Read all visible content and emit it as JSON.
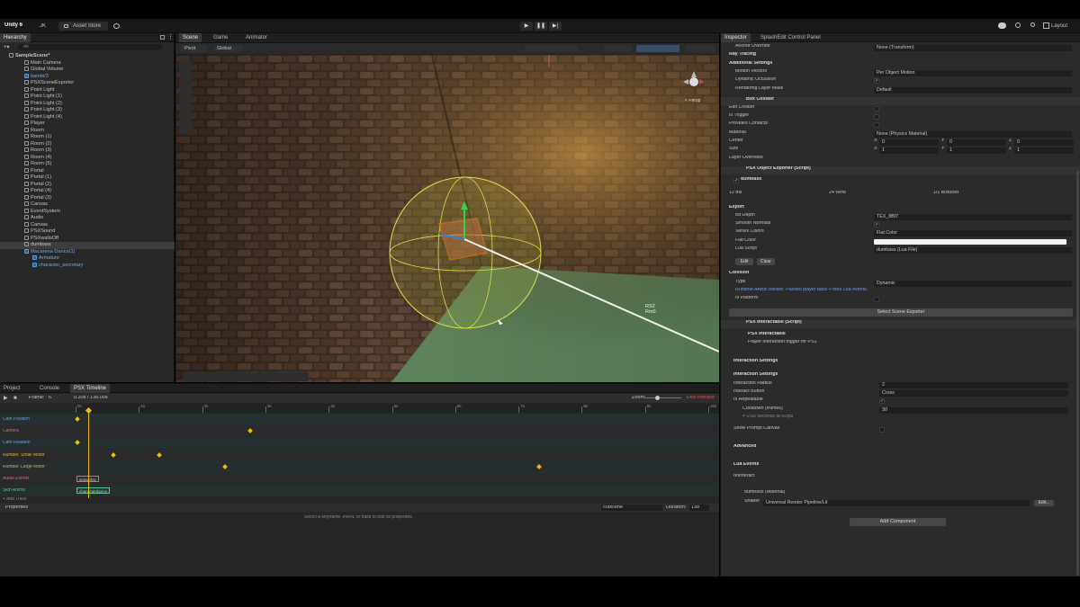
{
  "topbar": {
    "app": "Unity 6",
    "account": "JK",
    "store": "Asset Store",
    "layout": "Layout"
  },
  "hierarchy": {
    "tab": "Hierarchy",
    "search": "All",
    "items": [
      {
        "label": "SampleScene*",
        "indent": 0,
        "bold": true
      },
      {
        "label": "Main Camera",
        "indent": 1
      },
      {
        "label": "Global Volume",
        "indent": 1
      },
      {
        "label": "bambi/3",
        "indent": 1,
        "blue": true
      },
      {
        "label": "PSXSceneExporter",
        "indent": 1
      },
      {
        "label": "Point Light",
        "indent": 1
      },
      {
        "label": "Point Light (1)",
        "indent": 1
      },
      {
        "label": "Point Light (2)",
        "indent": 1
      },
      {
        "label": "Point Light (3)",
        "indent": 1
      },
      {
        "label": "Point Light (4)",
        "indent": 1
      },
      {
        "label": "Player",
        "indent": 1
      },
      {
        "label": "Room",
        "indent": 1
      },
      {
        "label": "Room (1)",
        "indent": 1
      },
      {
        "label": "Room (2)",
        "indent": 1
      },
      {
        "label": "Room (3)",
        "indent": 1
      },
      {
        "label": "Room (4)",
        "indent": 1
      },
      {
        "label": "Room (5)",
        "indent": 1
      },
      {
        "label": "Portal",
        "indent": 1
      },
      {
        "label": "Portal (1)",
        "indent": 1
      },
      {
        "label": "Portal (2)",
        "indent": 1
      },
      {
        "label": "Portal (4)",
        "indent": 1
      },
      {
        "label": "Portal (3)",
        "indent": 1
      },
      {
        "label": "Canvas",
        "indent": 1
      },
      {
        "label": "EventSystem",
        "indent": 1
      },
      {
        "label": "Audio",
        "indent": 1
      },
      {
        "label": "Canvas",
        "indent": 1
      },
      {
        "label": "PSXSound",
        "indent": 1
      },
      {
        "label": "PSXwallsOff",
        "indent": 1
      },
      {
        "label": "dumbass",
        "indent": 1,
        "selected": true
      },
      {
        "label": "Macarena Dance(1)",
        "indent": 1,
        "blue": true
      },
      {
        "label": "Armature",
        "indent": 2,
        "blue": true
      },
      {
        "label": "character_secretary",
        "indent": 2,
        "blue": true
      }
    ]
  },
  "scene": {
    "tabs": [
      "Scene",
      "Game",
      "Animator"
    ],
    "pivot": "Pivot",
    "global": "Global",
    "persp": "< Persp",
    "label1": "RS2",
    "label2": "Rm0"
  },
  "timeline": {
    "tabs": [
      "Project",
      "Console",
      "PSX Timeline"
    ],
    "frame_label": "Frame:",
    "frame": "6",
    "time": "0.20s / 138.00s",
    "zoom": "Zoom:",
    "end_preview": "End Preview",
    "ruler": [
      "0s",
      "1s",
      "2s",
      "3s",
      "4s",
      "5s",
      "6s",
      "7s",
      "8s",
      "9s",
      "10s"
    ],
    "tracks": [
      {
        "name": "Cam Position",
        "color": "#6fa0e8"
      },
      {
        "name": "Camera",
        "color": "#d06a8c"
      },
      {
        "name": "Cam Rotation",
        "color": "#6fa0e8"
      },
      {
        "name": "Rumble: Small Motor",
        "color": "#e0b040"
      },
      {
        "name": "Rumble: Large Motor",
        "color": "#e0b040"
      },
      {
        "name": "Audio Events",
        "color": "#d06a8c"
      },
      {
        "name": "Skin Anims",
        "color": "#5cc48a"
      }
    ],
    "audio_clip": "spawnfac",
    "anim_clip": "characterdance",
    "add_track": "+ Add Track",
    "properties": "Properties",
    "hint": "Select a keyframe, event, or track to edit its properties.",
    "cutscene": "cutscene",
    "duration_label": "Duration:",
    "duration": "138"
  },
  "inspector": {
    "tabs": [
      "Inspector",
      "SplashEdit Control Panel"
    ],
    "anchor_override_label": "Anchor Override",
    "anchor_override": "None (Transform)",
    "probe": "Probes",
    "ray_tracing": "Ray Tracing",
    "additional": "Additional Settings",
    "motion_vectors_label": "Motion Vectors",
    "motion_vectors": "Per Object Motion",
    "dynamic_occlusion": "Dynamic Occlusion",
    "rendering_layer_label": "Rendering Layer Mask",
    "rendering_layer": "Default",
    "box_collider": "Box Collider",
    "edit_collider": "Edit Collider",
    "is_trigger": "Is Trigger",
    "provides_contacts": "Provides Contacts",
    "material_label": "Material",
    "material": "None (Physics Material)",
    "center_label": "Center",
    "center": [
      "0",
      "0",
      "0"
    ],
    "size_label": "Size",
    "size": [
      "1",
      "1",
      "1"
    ],
    "layer_overrides": "Layer Overrides",
    "psx_exporter": "PSX Object Exporter (Script)",
    "obj_name": "dumbass",
    "tris": "12 tris",
    "verts": "24 verts",
    "textured": "1/1 textured",
    "export": "Export",
    "bit_depth_label": "Bit Depth",
    "bit_depth": "TEX_8BIT",
    "smooth_normals": "Smooth Normals",
    "vertex_colors_label": "Vertex Colors",
    "vertex_colors": "Flat Color",
    "flat_color": "Flat Color",
    "lua_script_label": "Lua Script",
    "lua_script": "dumbass (Lua File)",
    "edit": "Edit",
    "clear": "Clear",
    "collision": "Collision",
    "type_label": "Type",
    "type": "Dynamic",
    "collision_note": "Runtime AABB collider. Pushes player back + fires Lua events.",
    "is_platform": "Is Platform",
    "select_exporter": "Select Scene Exporter",
    "psx_interactable": "PSX Interactable (Script)",
    "interact_title": "PSX Interactable",
    "interact_desc": "Player interaction trigger for PS1",
    "interaction_settings": "Interaction Settings",
    "interaction_settings2": "Interaction Settings",
    "interaction_radius_label": "Interaction Radius",
    "interaction_radius": "2",
    "interact_button_label": "Interact Button",
    "interact_button": "Cross",
    "is_repeatable": "Is Repeatable",
    "cooldown_label": "Cooldown (frames)",
    "cooldown": "30",
    "cooldown_note": "= 0.50 seconds at 60fps",
    "show_prompt": "Show Prompt Canvas",
    "advanced": "Advanced",
    "lua_events": "Lua Events",
    "on_interact": "onInteract",
    "material_name": "dumbass (Material)",
    "shader_label": "Shader",
    "shader": "Universal Render Pipeline/Lit",
    "edit2": "Edit...",
    "add_component": "Add Component"
  },
  "colors": {
    "accent": "#3d7bd6",
    "orange": "#ff7a1a",
    "collider": "#c8d040",
    "floor": "#5f8a63"
  }
}
